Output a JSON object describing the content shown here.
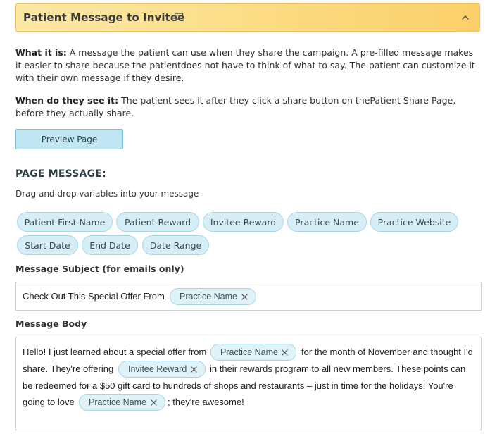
{
  "accordion": {
    "title": "Patient Message to Invitee"
  },
  "info": {
    "what_label": "What it is:",
    "what_text": "A message the patient can use when they share the campaign. A pre-filled message makes it easier to share because the patientdoes not have to think of what to say. The patient can customize it with their own message if they desire.",
    "when_label": "When do they see it:",
    "when_text": "The patient sees it after they click a share button on thePatient Share Page, before they actually share."
  },
  "preview_button": "Preview Page",
  "page_message": {
    "heading": "PAGE MESSAGE:",
    "instructions": "Drag and drop variables into your message",
    "variables": [
      "Patient First Name",
      "Patient Reward",
      "Invitee Reward",
      "Practice Name",
      "Practice Website",
      "Start Date",
      "End Date",
      "Date Range"
    ]
  },
  "subject": {
    "label": "Message Subject (for emails only)",
    "text": "Check Out This Special Offer From",
    "tag": "Practice Name"
  },
  "body": {
    "label": "Message Body",
    "line1_a": "Hello! I just learned about a special offer from",
    "line1_tag": "Practice Name",
    "line1_b": "for the month of November and thought I'd",
    "line2_a": "share. They're offering",
    "line2_tag": "Invitee Reward",
    "line2_b": "in their rewards program to all new members. These points can",
    "line3": "be redeemed for a $50 gift card to hundreds of shops and restaurants – just in time for the holidays! You're",
    "line4_a": "going to love",
    "line4_tag": "Practice Name",
    "line4_b": "; they're awesome!"
  }
}
